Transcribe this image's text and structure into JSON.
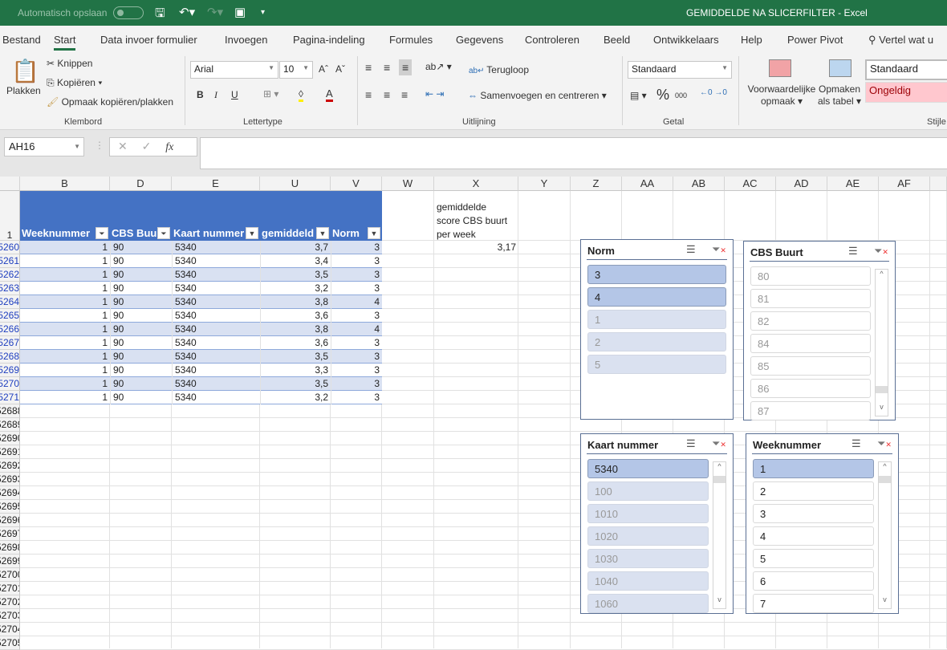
{
  "titlebar": {
    "autosave": "Automatisch opslaan",
    "title": "GEMIDDELDE NA SLICERFILTER  -  Excel"
  },
  "tabs": [
    "Bestand",
    "Start",
    "Data invoer formulier",
    "Invoegen",
    "Pagina-indeling",
    "Formules",
    "Gegevens",
    "Controleren",
    "Beeld",
    "Ontwikkelaars",
    "Help",
    "Power Pivot"
  ],
  "tell_me": "Vertel wat u",
  "ribbon": {
    "clipboard": {
      "paste": "Plakken",
      "cut": "Knippen",
      "copy": "Kopiëren",
      "format_painter": "Opmaak kopiëren/plakken",
      "label": "Klembord"
    },
    "font": {
      "name": "Arial",
      "size": "10",
      "bold": "B",
      "italic": "I",
      "underline": "U",
      "label": "Lettertype"
    },
    "alignment": {
      "wrap": "Terugloop",
      "merge": "Samenvoegen en centreren",
      "label": "Uitlijning"
    },
    "number": {
      "format": "Standaard",
      "percent": "%",
      "thousands": "000",
      "label": "Getal"
    },
    "styles": {
      "conditional": "Voorwaardelijke",
      "conditional2": "opmaak",
      "as_table": "Opmaken",
      "as_table2": "als tabel",
      "style1": "Standaard",
      "style2": "Ongeldig",
      "label": "Stijle"
    }
  },
  "formula_bar": {
    "name_box": "AH16",
    "formula": "",
    "fx": "fx"
  },
  "columns": [
    "B",
    "D",
    "E",
    "U",
    "V",
    "W",
    "X",
    "Y",
    "Z",
    "AA",
    "AB",
    "AC",
    "AD",
    "AE",
    "AF"
  ],
  "table": {
    "headers": [
      "Weeknummer",
      "CBS Buu",
      "Kaart nummer",
      "gemiddeld",
      "Norm"
    ],
    "row_numbers": [
      "5260",
      "5261",
      "5262",
      "5263",
      "5264",
      "5265",
      "5266",
      "5267",
      "5268",
      "5269",
      "5270",
      "5271"
    ],
    "rows": [
      [
        "1",
        "90",
        "5340",
        "3,7",
        "3"
      ],
      [
        "1",
        "90",
        "5340",
        "3,4",
        "3"
      ],
      [
        "1",
        "90",
        "5340",
        "3,5",
        "3"
      ],
      [
        "1",
        "90",
        "5340",
        "3,2",
        "3"
      ],
      [
        "1",
        "90",
        "5340",
        "3,8",
        "4"
      ],
      [
        "1",
        "90",
        "5340",
        "3,6",
        "3"
      ],
      [
        "1",
        "90",
        "5340",
        "3,8",
        "4"
      ],
      [
        "1",
        "90",
        "5340",
        "3,6",
        "3"
      ],
      [
        "1",
        "90",
        "5340",
        "3,5",
        "3"
      ],
      [
        "1",
        "90",
        "5340",
        "3,3",
        "3"
      ],
      [
        "1",
        "90",
        "5340",
        "3,5",
        "3"
      ],
      [
        "1",
        "90",
        "5340",
        "3,2",
        "3"
      ]
    ]
  },
  "header_row_number": "1",
  "extra_row_numbers": [
    "52688",
    "52689",
    "52690",
    "52691",
    "52692",
    "52693",
    "52694",
    "52695",
    "52696",
    "52697",
    "52698",
    "52699",
    "52700",
    "52701",
    "52702",
    "52703",
    "52704",
    "52705"
  ],
  "summary": {
    "label_lines": [
      "gemiddelde",
      "score CBS buurt",
      "per week"
    ],
    "value": "3,17"
  },
  "slicers": [
    {
      "title": "Norm",
      "items": [
        {
          "v": "3",
          "s": "sel"
        },
        {
          "v": "4",
          "s": "sel"
        },
        {
          "v": "1",
          "s": "nodata"
        },
        {
          "v": "2",
          "s": "nodata"
        },
        {
          "v": "5",
          "s": "nodata"
        }
      ],
      "scroll": false
    },
    {
      "title": "CBS Buurt",
      "items": [
        {
          "v": "80",
          "s": "unsel gray"
        },
        {
          "v": "81",
          "s": "unsel gray"
        },
        {
          "v": "82",
          "s": "unsel gray"
        },
        {
          "v": "84",
          "s": "unsel gray"
        },
        {
          "v": "85",
          "s": "unsel gray"
        },
        {
          "v": "86",
          "s": "unsel gray"
        },
        {
          "v": "87",
          "s": "unsel gray"
        }
      ],
      "scroll": true
    },
    {
      "title": "Kaart nummer",
      "items": [
        {
          "v": "5340",
          "s": "sel"
        },
        {
          "v": "100",
          "s": "nodata"
        },
        {
          "v": "1010",
          "s": "nodata"
        },
        {
          "v": "1020",
          "s": "nodata"
        },
        {
          "v": "1030",
          "s": "nodata"
        },
        {
          "v": "1040",
          "s": "nodata"
        },
        {
          "v": "1060",
          "s": "nodata"
        }
      ],
      "scroll": true
    },
    {
      "title": "Weeknummer",
      "items": [
        {
          "v": "1",
          "s": "sel"
        },
        {
          "v": "2",
          "s": "unsel"
        },
        {
          "v": "3",
          "s": "unsel"
        },
        {
          "v": "4",
          "s": "unsel"
        },
        {
          "v": "5",
          "s": "unsel"
        },
        {
          "v": "6",
          "s": "unsel"
        },
        {
          "v": "7",
          "s": "unsel"
        }
      ],
      "scroll": true
    }
  ]
}
